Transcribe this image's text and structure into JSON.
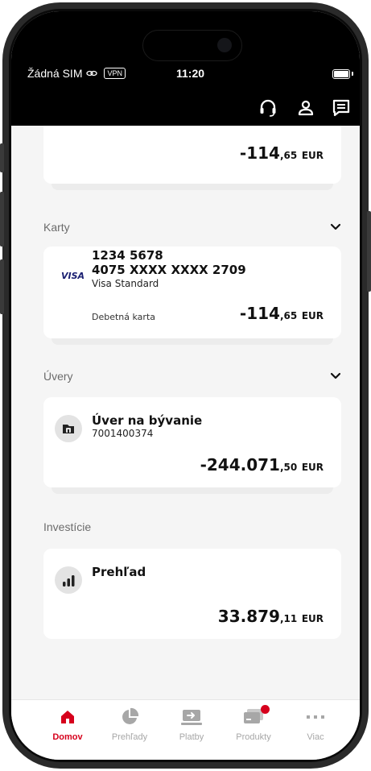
{
  "status_bar": {
    "carrier": "Žádná SIM",
    "vpn": "VPN",
    "time": "11:20"
  },
  "header": {
    "icons": [
      "headset-icon",
      "profile-icon",
      "messages-icon"
    ]
  },
  "account_card": {
    "amount_int": "-114",
    "amount_dec": ",65",
    "currency": "EUR"
  },
  "cards_section": {
    "title": "Karty",
    "card": {
      "line1": "1234 5678",
      "number": "4075 XXXX XXXX 2709",
      "brand_logo": "VISA",
      "product": "Visa Standard",
      "type": "Debetná karta",
      "amount_int": "-114",
      "amount_dec": ",65",
      "currency": "EUR"
    }
  },
  "loans_section": {
    "title": "Úvery",
    "loan": {
      "name": "Úver na bývanie",
      "number": "7001400374",
      "amount_int": "-244.071",
      "amount_dec": ",50",
      "currency": "EUR"
    }
  },
  "investments_section": {
    "title": "Investície",
    "item": {
      "name": "Prehľad",
      "amount_int": "33.879",
      "amount_dec": ",11",
      "currency": "EUR"
    }
  },
  "tabbar": {
    "tabs": [
      {
        "label": "Domov",
        "icon": "home-icon",
        "active": true
      },
      {
        "label": "Prehľady",
        "icon": "pie-chart-icon",
        "active": false
      },
      {
        "label": "Platby",
        "icon": "transfer-icon",
        "active": false
      },
      {
        "label": "Produkty",
        "icon": "cards-icon",
        "active": false
      },
      {
        "label": "Viac",
        "icon": "more-icon",
        "active": false
      }
    ]
  },
  "colors": {
    "accent": "#d6001c",
    "visa_blue": "#1a1f71",
    "background": "#f5f5f5"
  }
}
